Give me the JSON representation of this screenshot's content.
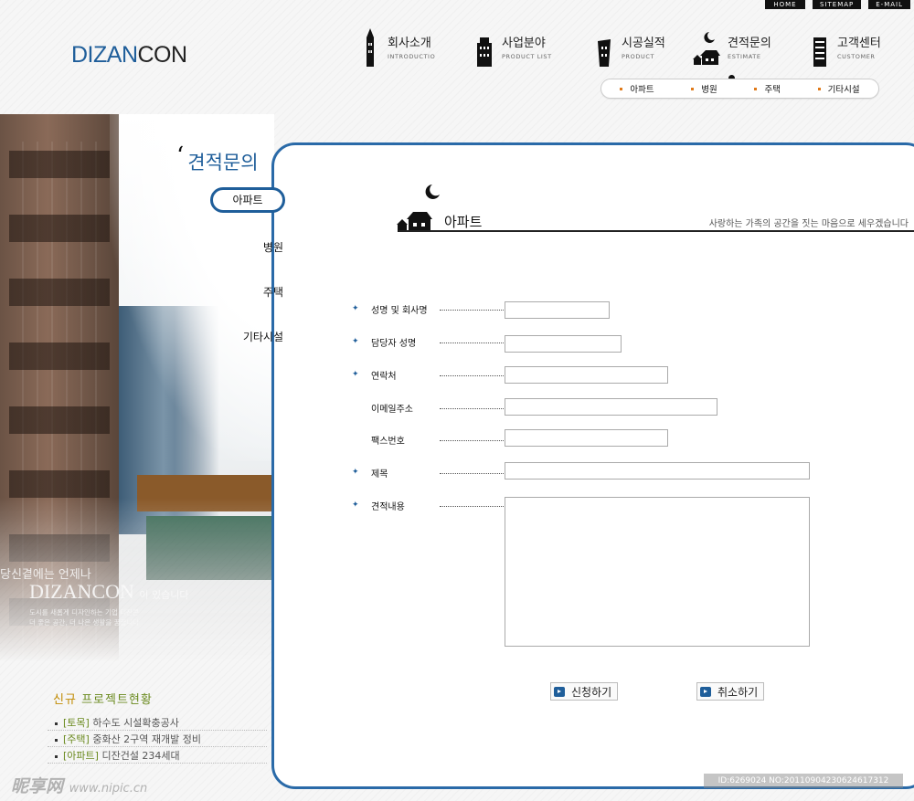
{
  "utility": [
    "HOME",
    "SITEMAP",
    "E-MAIL"
  ],
  "logo": {
    "part1": "DIZAN",
    "part2": "CON"
  },
  "nav": [
    {
      "ko": "회사소개",
      "en": "INTRODUCTIO"
    },
    {
      "ko": "사업분야",
      "en": "PRODUCT LIST"
    },
    {
      "ko": "시공실적",
      "en": "PRODUCT"
    },
    {
      "ko": "견적문의",
      "en": "ESTIMATE"
    },
    {
      "ko": "고객센터",
      "en": "CUSTOMER"
    }
  ],
  "subnav": [
    "아파트",
    "병원",
    "주택",
    "기타시설"
  ],
  "sidebar": {
    "title": "견적문의",
    "items": [
      "아파트",
      "병원",
      "주택",
      "기타시설"
    ]
  },
  "photo": {
    "tagline1": "당신곁에는 언제나",
    "brand": "DIZANCON",
    "tagline2": "이 있습니다",
    "small1": "도시를 새롭게 디자인하는 기업 디잔콘",
    "small2": "더 좋은 공간, 더 나은 생활을 꿈꿉니다"
  },
  "content": {
    "title": "아파트",
    "slogan": "사랑하는 가족의 공간을 짓는 마음으로 세우겠습니다"
  },
  "form": {
    "fields": [
      {
        "label": "성명 및 회사명",
        "required": true
      },
      {
        "label": "담당자 성명",
        "required": true
      },
      {
        "label": "연락처",
        "required": true
      },
      {
        "label": "이메일주소",
        "required": false
      },
      {
        "label": "팩스번호",
        "required": false
      },
      {
        "label": "제목",
        "required": true
      },
      {
        "label": "견적내용",
        "required": true
      }
    ],
    "submit_label": "신청하기",
    "cancel_label": "취소하기"
  },
  "projects": {
    "title_a": "신규",
    "title_b": "프로젝트현황",
    "items": [
      {
        "tag": "[토목]",
        "text": "하수도 시설확충공사"
      },
      {
        "tag": "[주택]",
        "text": "중화산 2구역 재개발 정비"
      },
      {
        "tag": "[아파트]",
        "text": "디잔건설 234세대"
      }
    ]
  },
  "watermark": {
    "site": "昵享网",
    "url": "www.nipic.cn",
    "id": "ID:6269024 NO:20110904230624617312"
  },
  "colors": {
    "accent": "#1f5e9a",
    "dark": "#111111",
    "orange": "#e07a1a",
    "green": "#6a8a1e"
  }
}
